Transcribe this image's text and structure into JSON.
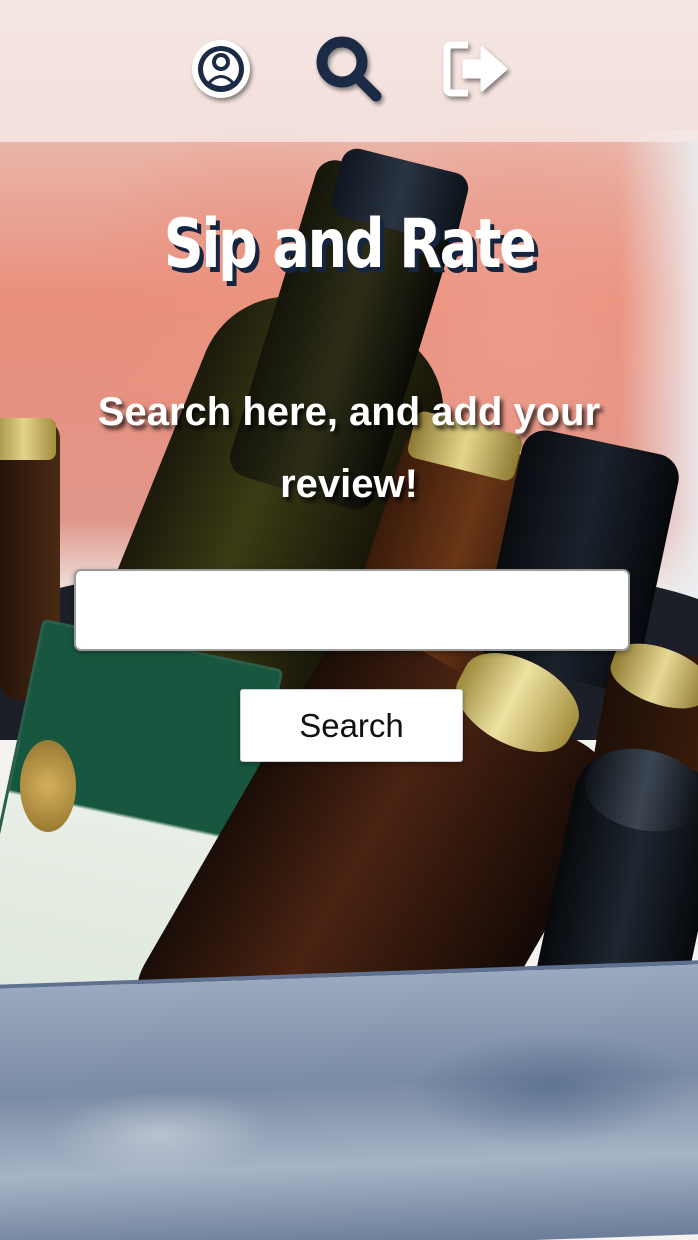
{
  "nav": {
    "items": [
      {
        "icon": "user-circle-icon",
        "label": ""
      },
      {
        "icon": "search-icon",
        "label": ""
      },
      {
        "icon": "sign-out-icon",
        "label": ""
      }
    ]
  },
  "hero": {
    "title": "Sip and Rate",
    "subtitle": "Search here, and add your review!"
  },
  "search": {
    "value": "",
    "placeholder": "",
    "button_label": "Search"
  },
  "colors": {
    "title_shadow": "#16253f",
    "icon_dark": "#1c2b45",
    "icon_light": "#ffffff"
  }
}
